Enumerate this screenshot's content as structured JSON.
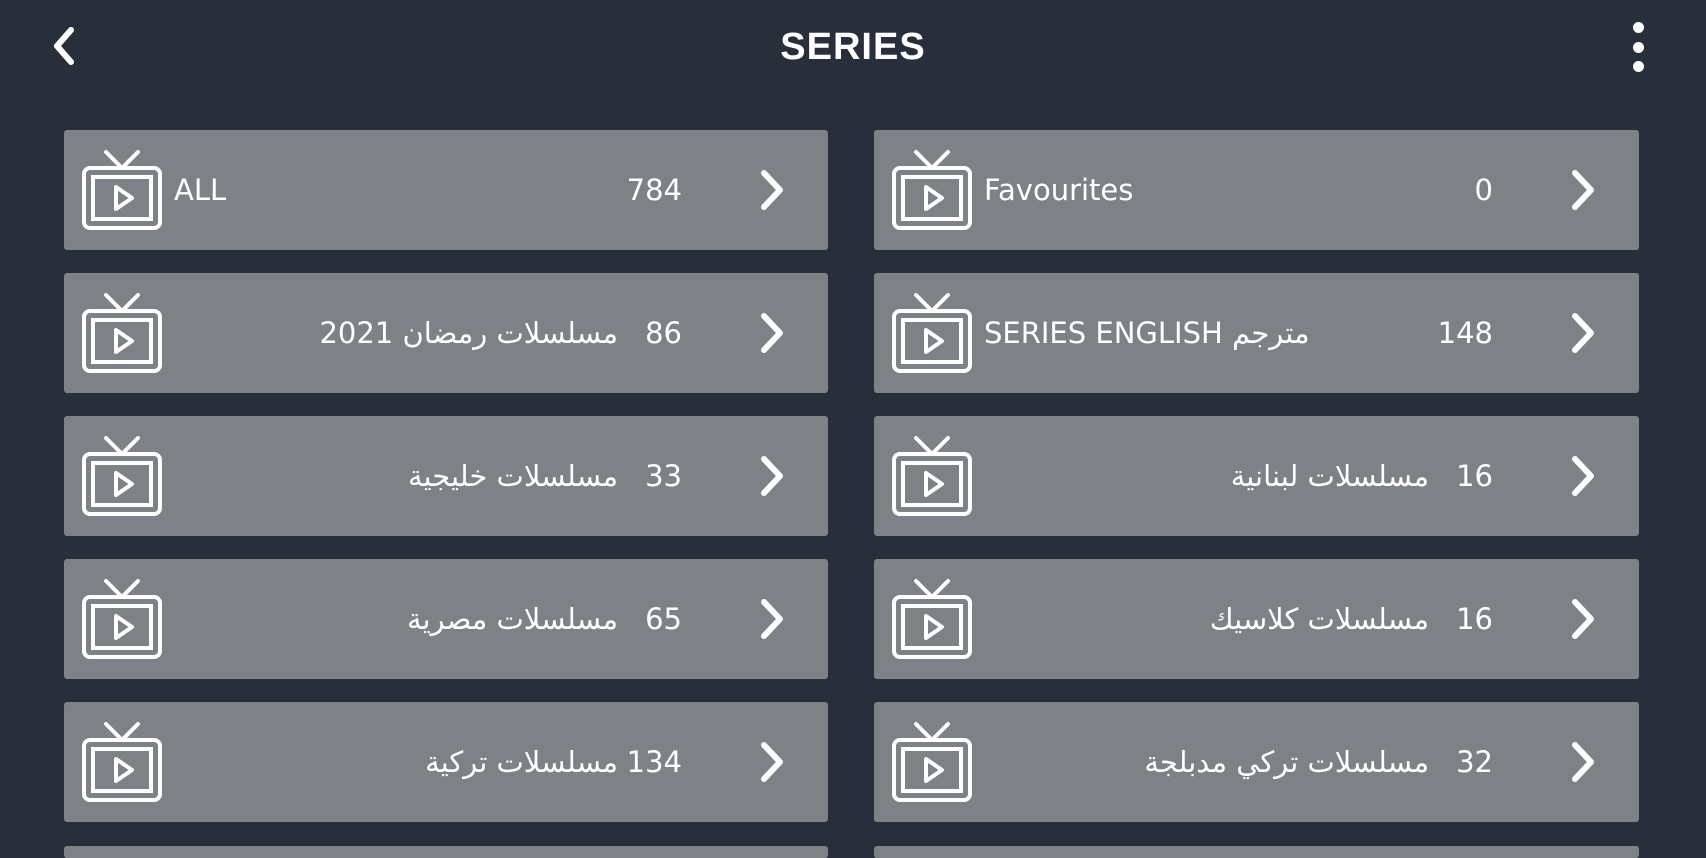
{
  "header": {
    "title": "SERIES",
    "back_icon": "chevron-left-icon",
    "menu_icon": "more-vertical-icon"
  },
  "colors": {
    "background": "#282e3a",
    "card": "#7e8287",
    "text": "#ffffff"
  },
  "categories": [
    {
      "name": "ALL",
      "count": "784",
      "rtl": false
    },
    {
      "name": "Favourites",
      "count": "0",
      "rtl": false
    },
    {
      "name": "مسلسلات رمضان 2021",
      "count": "86",
      "rtl": true
    },
    {
      "name": "SERIES ENGLISH مترجم",
      "count": "148",
      "rtl": false
    },
    {
      "name": "مسلسلات خليجية",
      "count": "33",
      "rtl": true
    },
    {
      "name": "مسلسلات لبنانية",
      "count": "16",
      "rtl": true
    },
    {
      "name": "مسلسلات مصرية",
      "count": "65",
      "rtl": true
    },
    {
      "name": "مسلسلات كلاسيك",
      "count": "16",
      "rtl": true
    },
    {
      "name": "مسلسلات تركية",
      "count": "134",
      "rtl": true
    },
    {
      "name": "مسلسلات تركي مدبلجة",
      "count": "32",
      "rtl": true
    }
  ]
}
